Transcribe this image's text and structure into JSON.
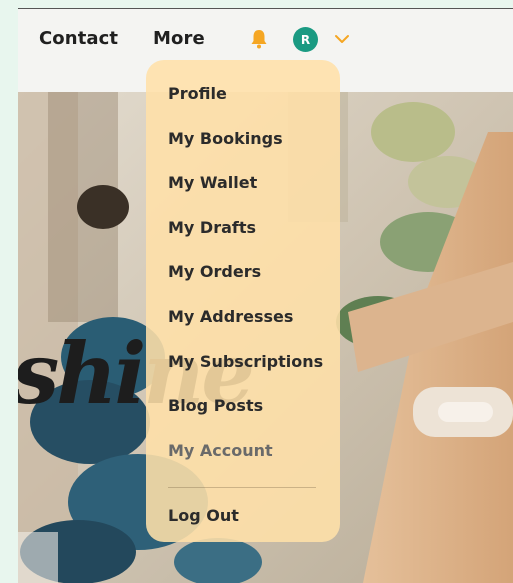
{
  "nav": {
    "contact_label": "Contact",
    "more_label": "More",
    "avatar_initial": "R"
  },
  "hero": {
    "script_text": "shine"
  },
  "colors": {
    "accent_orange": "#f5a623",
    "avatar_teal": "#1a9a82",
    "menu_bg": "#ffe0a8"
  },
  "icons": {
    "bell": "bell-icon",
    "chevron": "chevron-down-icon"
  },
  "account_menu": {
    "items": [
      {
        "label": "Profile"
      },
      {
        "label": "My Bookings"
      },
      {
        "label": "My Wallet"
      },
      {
        "label": "My Drafts"
      },
      {
        "label": "My Orders"
      },
      {
        "label": "My Addresses"
      },
      {
        "label": "My Subscriptions"
      },
      {
        "label": "Blog Posts"
      },
      {
        "label": "My Account"
      }
    ],
    "logout_label": "Log Out"
  }
}
